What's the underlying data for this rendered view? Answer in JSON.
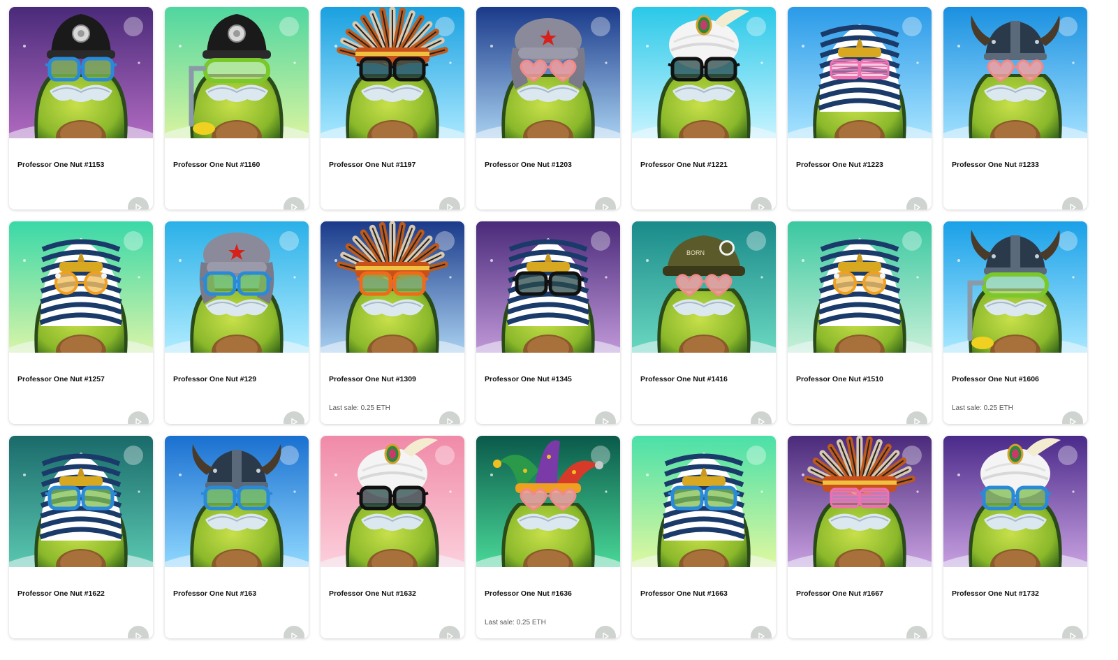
{
  "page": {
    "background": "#ffffff"
  },
  "items": [
    {
      "title": "Professor One Nut #1153",
      "last_sale": "",
      "bg_top": "#4a2a7a",
      "bg_bottom": "#b06ac0",
      "hat": "police",
      "glasses": "blue",
      "glasses_color": "#2a8ad8",
      "lens_color": "#7fbf4f"
    },
    {
      "title": "Professor One Nut #1160",
      "last_sale": "",
      "bg_top": "#4fd6a0",
      "bg_bottom": "#d8f4a0",
      "hat": "police",
      "glasses": "snorkel",
      "glasses_color": "#7ac82a",
      "lens_color": "#c8e8a0"
    },
    {
      "title": "Professor One Nut #1197",
      "last_sale": "",
      "bg_top": "#1aa0e0",
      "bg_bottom": "#a8e8ff",
      "hat": "feathers",
      "glasses": "black",
      "glasses_color": "#111111",
      "lens_color": "#2a4a4a"
    },
    {
      "title": "Professor One Nut #1203",
      "last_sale": "",
      "bg_top": "#1a3a8a",
      "bg_bottom": "#a8d0f0",
      "hat": "ushanka",
      "glasses": "hearts",
      "glasses_color": "#f08a8a",
      "lens_color": "#f4a0a0"
    },
    {
      "title": "Professor One Nut #1221",
      "last_sale": "",
      "bg_top": "#2ac8e8",
      "bg_bottom": "#c8f4ff",
      "hat": "turban",
      "glasses": "black",
      "glasses_color": "#111111",
      "lens_color": "#2a4a4a"
    },
    {
      "title": "Professor One Nut #1223",
      "last_sale": "",
      "bg_top": "#2a9ae8",
      "bg_bottom": "#a8e4ff",
      "hat": "pharaoh",
      "glasses": "shutter",
      "glasses_color": "#f070b0",
      "lens_color": "#f0a0c8"
    },
    {
      "title": "Professor One Nut #1233",
      "last_sale": "",
      "bg_top": "#1a90e0",
      "bg_bottom": "#a0e0ff",
      "hat": "viking",
      "glasses": "hearts",
      "glasses_color": "#f08a8a",
      "lens_color": "#f4a0a0"
    },
    {
      "title": "Professor One Nut #1257",
      "last_sale": "",
      "bg_top": "#3ad8a8",
      "bg_bottom": "#d8f4a8",
      "hat": "pharaoh",
      "glasses": "round",
      "glasses_color": "#f0a020",
      "lens_color": "#f4c060"
    },
    {
      "title": "Professor One Nut #129",
      "last_sale": "",
      "bg_top": "#2ab0e8",
      "bg_bottom": "#b0ecff",
      "hat": "ushanka",
      "glasses": "blue",
      "glasses_color": "#2a8ad8",
      "lens_color": "#7fbf4f"
    },
    {
      "title": "Professor One Nut #1309",
      "last_sale": "Last sale: 0.25 ETH",
      "bg_top": "#1a3a8a",
      "bg_bottom": "#a8d0f0",
      "hat": "feathers",
      "glasses": "orange",
      "glasses_color": "#f06a1a",
      "lens_color": "#8ab858"
    },
    {
      "title": "Professor One Nut #1345",
      "last_sale": "",
      "bg_top": "#4a2a7a",
      "bg_bottom": "#c098d8",
      "hat": "pharaoh",
      "glasses": "black",
      "glasses_color": "#111111",
      "lens_color": "#2a4a4a"
    },
    {
      "title": "Professor One Nut #1416",
      "last_sale": "",
      "bg_top": "#1a8a8a",
      "bg_bottom": "#6ad8c0",
      "hat": "helmet",
      "glasses": "hearts",
      "glasses_color": "#f08a8a",
      "lens_color": "#f4a0a0"
    },
    {
      "title": "Professor One Nut #1510",
      "last_sale": "",
      "bg_top": "#3ac8a0",
      "bg_bottom": "#c8f0d8",
      "hat": "pharaoh",
      "glasses": "round",
      "glasses_color": "#f0a020",
      "lens_color": "#f4c060"
    },
    {
      "title": "Professor One Nut #1606",
      "last_sale": "Last sale: 0.25 ETH",
      "bg_top": "#1aa0e8",
      "bg_bottom": "#a8e8ff",
      "hat": "viking",
      "glasses": "snorkel",
      "glasses_color": "#7ac82a",
      "lens_color": "#c8e8a0"
    },
    {
      "title": "Professor One Nut #1622",
      "last_sale": "",
      "bg_top": "#1a6a6a",
      "bg_bottom": "#5ac8b0",
      "hat": "pharaoh",
      "glasses": "blue",
      "glasses_color": "#2a8ad8",
      "lens_color": "#7fbf4f"
    },
    {
      "title": "Professor One Nut #163",
      "last_sale": "",
      "bg_top": "#1a70d0",
      "bg_bottom": "#90d8ff",
      "hat": "viking",
      "glasses": "blue",
      "glasses_color": "#2a8ad8",
      "lens_color": "#7fbf4f"
    },
    {
      "title": "Professor One Nut #1632",
      "last_sale": "",
      "bg_top": "#f08aa8",
      "bg_bottom": "#fcd0dc",
      "hat": "turban",
      "glasses": "black",
      "glasses_color": "#111111",
      "lens_color": "#2a4a4a"
    },
    {
      "title": "Professor One Nut #1636",
      "last_sale": "Last sale: 0.25 ETH",
      "bg_top": "#0a5a4a",
      "bg_bottom": "#4ad898",
      "hat": "jester",
      "glasses": "hearts",
      "glasses_color": "#f08a8a",
      "lens_color": "#f4a0a0"
    },
    {
      "title": "Professor One Nut #1663",
      "last_sale": "",
      "bg_top": "#4ae0a8",
      "bg_bottom": "#e0f8a0",
      "hat": "pharaoh",
      "glasses": "blue",
      "glasses_color": "#2a8ad8",
      "lens_color": "#7fbf4f"
    },
    {
      "title": "Professor One Nut #1667",
      "last_sale": "",
      "bg_top": "#4a2a7a",
      "bg_bottom": "#c8a0e0",
      "hat": "feathers",
      "glasses": "shutter",
      "glasses_color": "#f070b0",
      "lens_color": "#f0a0c8"
    },
    {
      "title": "Professor One Nut #1732",
      "last_sale": "",
      "bg_top": "#4a2a8a",
      "bg_bottom": "#c8a0e0",
      "hat": "turban",
      "glasses": "blue",
      "glasses_color": "#2a8ad8",
      "lens_color": "#7fbf4f"
    }
  ]
}
